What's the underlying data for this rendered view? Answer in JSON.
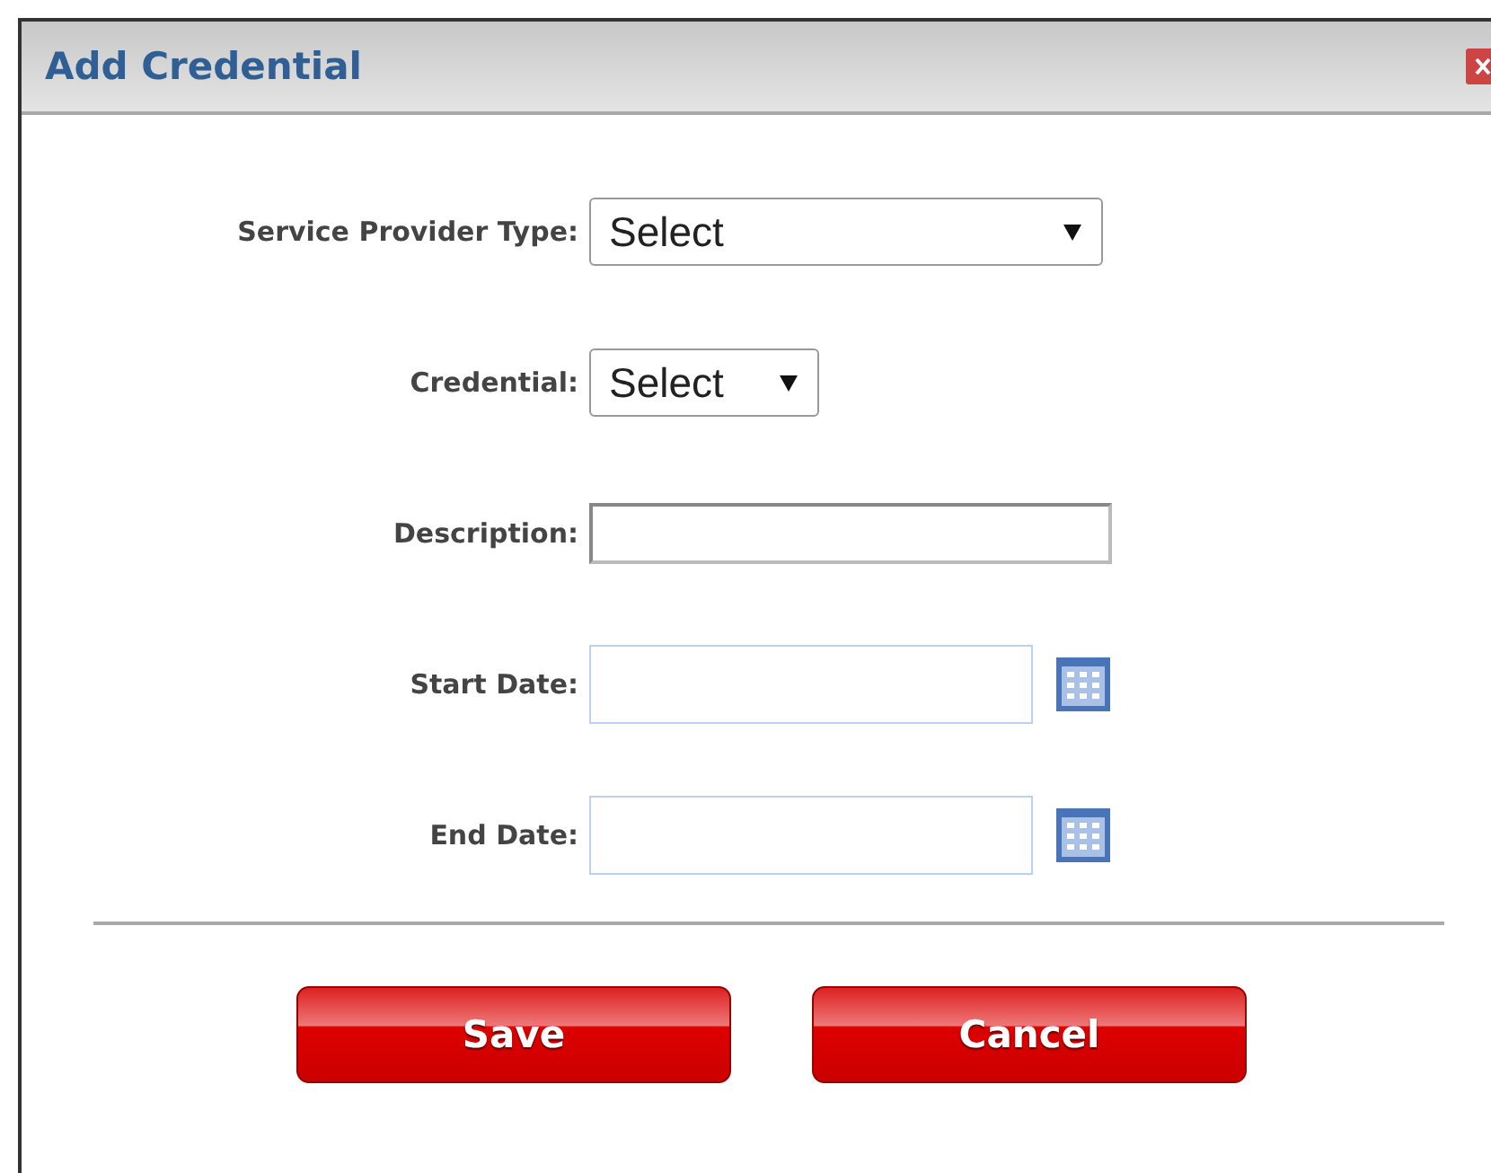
{
  "window": {
    "title": "Add Credential"
  },
  "fields": [
    {
      "label": "Service Provider Type:",
      "kind": "select",
      "value": "Select"
    },
    {
      "label": "Credential:",
      "kind": "select",
      "value": "Select"
    },
    {
      "label": "Description:",
      "kind": "text"
    },
    {
      "label": "Start Date:",
      "kind": "date"
    },
    {
      "label": "End Date:",
      "kind": "date"
    }
  ],
  "buttons": [
    "Save",
    "Cancel"
  ]
}
